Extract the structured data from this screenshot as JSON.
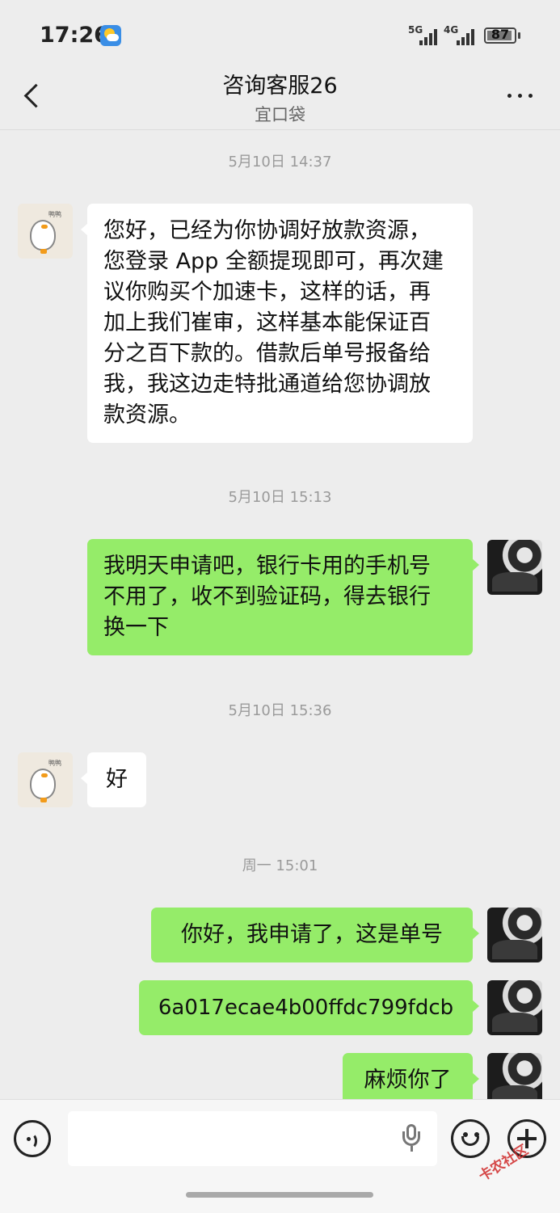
{
  "status_bar": {
    "time": "17:26",
    "network1": "5G",
    "network2": "4G",
    "battery": "87"
  },
  "header": {
    "title": "咨询客服26",
    "subtitle": "宜口袋"
  },
  "messages": [
    {
      "type": "timestamp",
      "text": "5月10日 14:37"
    },
    {
      "type": "incoming",
      "lines": [
        "您好，已经为你协调好放款资源，",
        "您登录 App 全额提现即可，再次建",
        "议你购买个加速卡，这样的话，再",
        "加上我们崔审，这样基本能保证百",
        "分之百下款的。借款后单号报备给",
        "我，我这边走特批通道给您协调放",
        "款资源。"
      ]
    },
    {
      "type": "timestamp",
      "text": "5月10日 15:13"
    },
    {
      "type": "outgoing",
      "lines": [
        "我明天申请吧，银行卡用的手机号",
        "不用了，收不到验证码，得去银行",
        "换一下"
      ]
    },
    {
      "type": "timestamp",
      "text": "5月10日 15:36"
    },
    {
      "type": "incoming",
      "lines": [
        "好"
      ]
    },
    {
      "type": "timestamp",
      "text": "周一 15:01"
    },
    {
      "type": "outgoing",
      "lines": [
        "你好，我申请了，这是单号"
      ]
    },
    {
      "type": "outgoing",
      "lines": [
        "6a017ecae4b00ffdc799fdcb"
      ]
    },
    {
      "type": "outgoing",
      "lines": [
        "麻烦你了"
      ]
    }
  ],
  "input_bar": {
    "placeholder": "",
    "watermark": "卡农社区"
  },
  "colors": {
    "outgoing_bubble": "#95ec69",
    "incoming_bubble": "#ffffff",
    "background": "#ededed"
  },
  "icons": [
    "weather-icon",
    "signal-5g-icon",
    "signal-4g-icon",
    "battery-icon",
    "back-arrow-icon",
    "more-dots-icon",
    "voice-icon",
    "mic-icon",
    "emoji-icon",
    "plus-icon"
  ]
}
